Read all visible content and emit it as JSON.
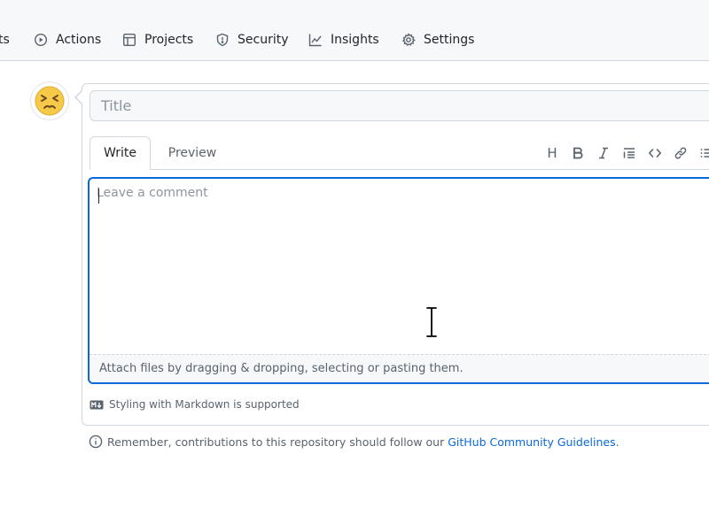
{
  "nav": {
    "items": [
      {
        "label": "ts",
        "icon": "pull-request-icon"
      },
      {
        "label": "Actions",
        "icon": "play-icon"
      },
      {
        "label": "Projects",
        "icon": "table-icon"
      },
      {
        "label": "Security",
        "icon": "shield-icon"
      },
      {
        "label": "Insights",
        "icon": "graph-icon"
      },
      {
        "label": "Settings",
        "icon": "gear-icon"
      }
    ]
  },
  "avatar": {
    "emoji": "😣"
  },
  "form": {
    "title_placeholder": "Title",
    "tabs": [
      "Write",
      "Preview"
    ],
    "toolbar": [
      "heading",
      "bold",
      "italic",
      "quote",
      "code",
      "link",
      "list"
    ],
    "toolbar_letters": {
      "heading": "H"
    },
    "comment_placeholder": "Leave a comment",
    "attach_text": "Attach files by dragging & dropping, selecting or pasting them.",
    "markdown_note": "Styling with Markdown is supported"
  },
  "footer": {
    "guidelines_prefix": "Remember, contributions to this repository should follow our ",
    "guidelines_link": "GitHub Community Guidelines",
    "guidelines_suffix": "."
  },
  "colors": {
    "accent": "#0969da",
    "border": "#d0d7de",
    "muted": "#59636e"
  }
}
